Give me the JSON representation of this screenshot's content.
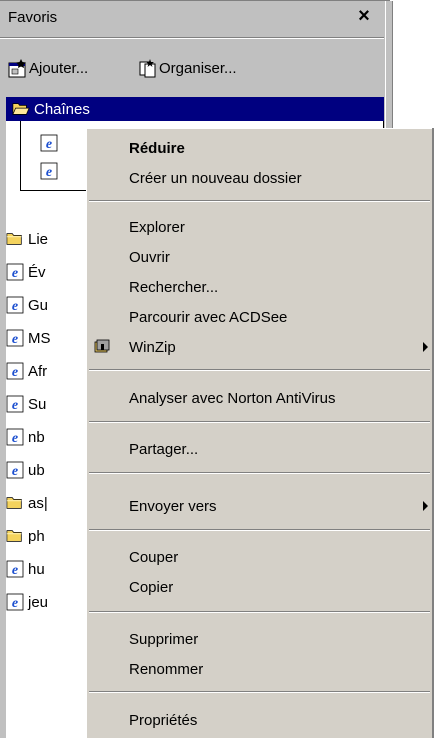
{
  "pane": {
    "title": "Favoris",
    "close_glyph": "×",
    "toolbar": {
      "add_label": "Ajouter...",
      "organize_label": "Organiser..."
    }
  },
  "tree": {
    "selected_folder": "Chaînes",
    "visible_items": [
      {
        "label": "Lie",
        "icon": "folder-icon"
      },
      {
        "label": "Év",
        "icon": "ie-page-icon"
      },
      {
        "label": "Gu",
        "icon": "ie-page-icon"
      },
      {
        "label": "MS",
        "icon": "ie-page-icon"
      },
      {
        "label": "Afr",
        "icon": "ie-page-icon"
      },
      {
        "label": "Su",
        "icon": "ie-page-icon"
      },
      {
        "label": "nb",
        "icon": "ie-page-icon"
      },
      {
        "label": "ub",
        "icon": "ie-page-icon"
      },
      {
        "label": "as|",
        "icon": "folder-icon"
      },
      {
        "label": "ph",
        "icon": "folder-icon"
      },
      {
        "label": "hu",
        "icon": "ie-page-icon"
      },
      {
        "label": "jeu",
        "icon": "ie-page-icon"
      }
    ]
  },
  "menu": {
    "groups": [
      [
        "Réduire",
        "Créer un nouveau dossier"
      ],
      [
        "Explorer",
        "Ouvrir",
        "Rechercher...",
        "Parcourir avec ACDSee",
        "WinZip"
      ],
      [
        "Analyser avec Norton AntiVirus"
      ],
      [
        "Partager..."
      ],
      [
        "Envoyer vers"
      ],
      [
        "Couper",
        "Copier"
      ],
      [
        "Supprimer",
        "Renommer"
      ],
      [
        "Propriétés"
      ]
    ],
    "reduce": "Réduire",
    "new_folder": "Créer un nouveau dossier",
    "explore": "Explorer",
    "open": "Ouvrir",
    "search": "Rechercher...",
    "acdsee": "Parcourir avec ACDSee",
    "winzip": "WinZip",
    "norton": "Analyser avec Norton AntiVirus",
    "share": "Partager...",
    "send_to": "Envoyer vers",
    "cut": "Couper",
    "copy": "Copier",
    "delete": "Supprimer",
    "rename": "Renommer",
    "properties": "Propriétés"
  },
  "colors": {
    "selection": "#000080",
    "menu_bg": "#d4d0c8",
    "pane_bg": "#c0c0c0",
    "folder_yellow": "#f4d35e",
    "ie_blue": "#1c4fd0"
  }
}
